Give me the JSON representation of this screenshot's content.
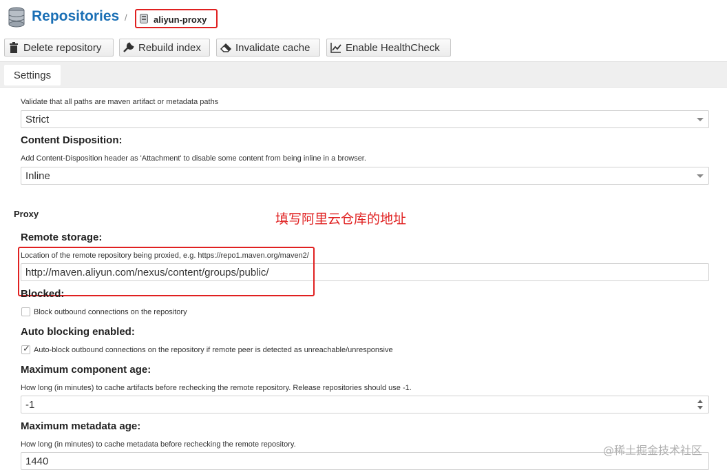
{
  "header": {
    "title": "Repositories",
    "separator": "/",
    "breadcrumb": "aliyun-proxy"
  },
  "toolbar": {
    "delete": "Delete repository",
    "rebuild": "Rebuild index",
    "invalidate": "Invalidate cache",
    "healthcheck": "Enable HealthCheck"
  },
  "tabs": {
    "settings": "Settings"
  },
  "form": {
    "layout_policy": {
      "hint": "Validate that all paths are maven artifact or metadata paths",
      "value": "Strict"
    },
    "content_disposition": {
      "label": "Content Disposition:",
      "hint": "Add Content-Disposition header as 'Attachment' to disable some content from being inline in a browser.",
      "value": "Inline"
    },
    "proxy_section": "Proxy",
    "remote_storage": {
      "label": "Remote storage:",
      "hint": "Location of the remote repository being proxied, e.g. https://repo1.maven.org/maven2/",
      "value": "http://maven.aliyun.com/nexus/content/groups/public/"
    },
    "blocked": {
      "label": "Blocked:",
      "checkbox_label": "Block outbound connections on the repository",
      "checked": false
    },
    "auto_blocking": {
      "label": "Auto blocking enabled:",
      "checkbox_label": "Auto-block outbound connections on the repository if remote peer is detected as unreachable/unresponsive",
      "checked": true
    },
    "max_component_age": {
      "label": "Maximum component age:",
      "hint": "How long (in minutes) to cache artifacts before rechecking the remote repository. Release repositories should use -1.",
      "value": "-1"
    },
    "max_metadata_age": {
      "label": "Maximum metadata age:",
      "hint": "How long (in minutes) to cache metadata before rechecking the remote repository.",
      "value": "1440"
    }
  },
  "annotation": {
    "text": "填写阿里云仓库的地址"
  },
  "watermark": "@稀土掘金技术社区",
  "colors": {
    "accent": "#1a6fb5",
    "annotation": "#e02020"
  }
}
